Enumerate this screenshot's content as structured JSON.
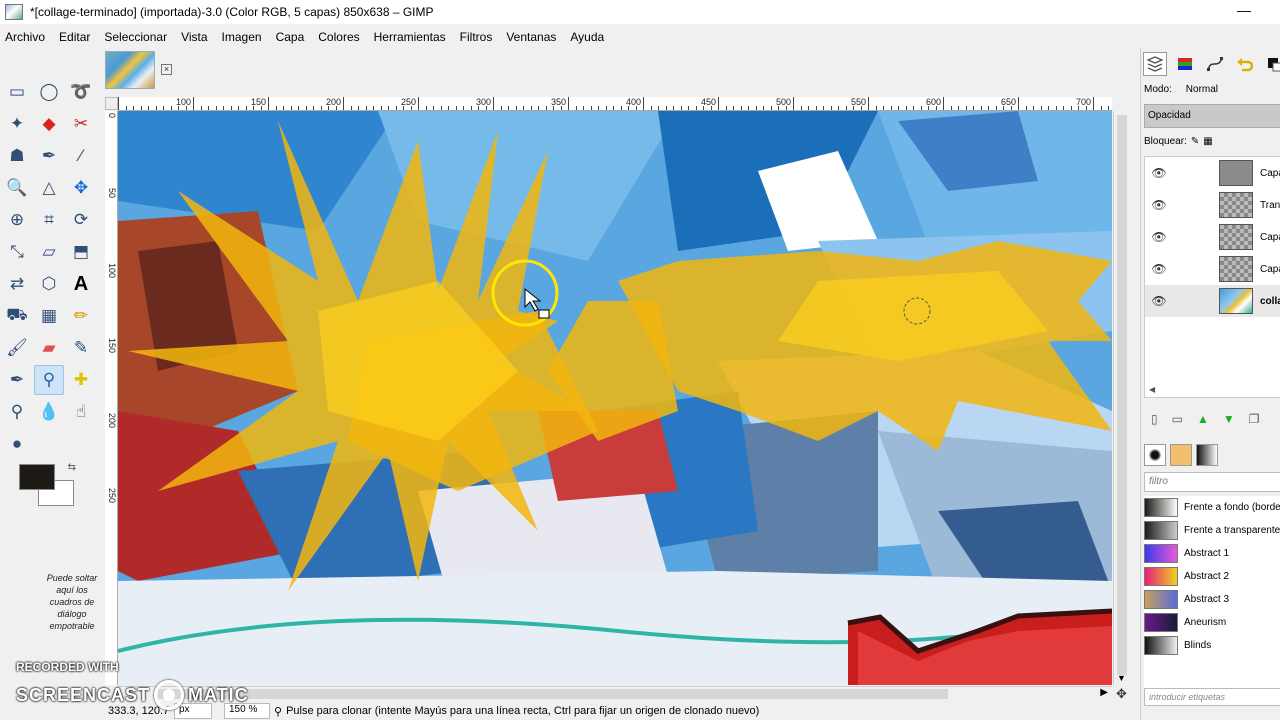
{
  "window": {
    "title": "*[collage-terminado] (importada)-3.0 (Color RGB, 5 capas) 850x638 – GIMP",
    "minimize_label": "—"
  },
  "menu": [
    "Archivo",
    "Editar",
    "Seleccionar",
    "Vista",
    "Imagen",
    "Capa",
    "Colores",
    "Herramientas",
    "Filtros",
    "Ventanas",
    "Ayuda"
  ],
  "toolbox": {
    "tools": [
      "rect-select",
      "ellipse-select",
      "free-select",
      "fuzzy-select",
      "color-select",
      "scissors-select",
      "foreground-select",
      "paths",
      "color-picker",
      "zoom",
      "measure",
      "move",
      "align",
      "crop",
      "rotate",
      "scale",
      "shear",
      "perspective",
      "flip",
      "cage-transform",
      "text",
      "bucket-fill",
      "blend",
      "pencil",
      "paintbrush",
      "eraser",
      "airbrush",
      "ink",
      "clone",
      "heal",
      "perspective-clone",
      "blur",
      "smudge",
      "dodge-burn"
    ],
    "selected_tool": "clone",
    "fg_color": "#1e1b16",
    "bg_color": "#ffffff",
    "drop_hint": "Puede soltar aquí los cuadros de diálogo empotrable"
  },
  "image_tab": {
    "close_label": "×"
  },
  "rulers": {
    "h_labels": [
      "100",
      "150",
      "200",
      "250",
      "300",
      "350",
      "400",
      "450",
      "500",
      "550",
      "600",
      "650",
      "700"
    ],
    "v_labels": [
      "0",
      "50",
      "100",
      "150",
      "200",
      "250"
    ]
  },
  "statusbar": {
    "coords": "333.3, 120.7",
    "unit": "px",
    "zoom": "150 %",
    "message": "Pulse para clonar (intente Mayús para una línea recta, Ctrl para fijar un origen de clonado nuevo)"
  },
  "layers_dock": {
    "mode_label": "Modo:",
    "mode_value": "Normal",
    "opacity_label": "Opacidad",
    "lock_label": "Bloquear:",
    "layers": [
      {
        "name": "Capa",
        "thumb": "sun",
        "active": false
      },
      {
        "name": "Trans",
        "thumb": "checker",
        "active": false
      },
      {
        "name": "Capa",
        "thumb": "checker",
        "active": false
      },
      {
        "name": "Capa",
        "thumb": "checker",
        "active": false
      },
      {
        "name": "colla",
        "thumb": "img",
        "active": true
      }
    ]
  },
  "gradients_dock": {
    "filter_placeholder": "filtro",
    "tags_placeholder": "introducir etiquetas",
    "gradients": [
      {
        "name": "Frente a fondo (borde",
        "colors": [
          "#1e1b16",
          "#ffffff"
        ]
      },
      {
        "name": "Frente a transparente",
        "colors": [
          "#1e1b16",
          "#cccccc"
        ]
      },
      {
        "name": "Abstract 1",
        "colors": [
          "#3a3ae8",
          "#e85ad8"
        ]
      },
      {
        "name": "Abstract 2",
        "colors": [
          "#e8207a",
          "#f0d020"
        ]
      },
      {
        "name": "Abstract 3",
        "colors": [
          "#c8a060",
          "#5a6ad8"
        ]
      },
      {
        "name": "Aneurism",
        "colors": [
          "#6a1a8a",
          "#1a1a3a"
        ]
      },
      {
        "name": "Blinds",
        "colors": [
          "#111111",
          "#f0f0f0"
        ]
      }
    ]
  },
  "watermark": {
    "line1": "RECORDED WITH",
    "brand_left": "SCREENCAST",
    "brand_right": "MATIC"
  }
}
